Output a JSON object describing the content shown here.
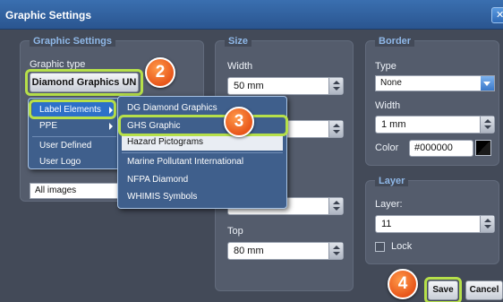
{
  "window": {
    "title": "Graphic Settings",
    "close_icon": "close-icon"
  },
  "graphic_settings": {
    "legend": "Graphic Settings",
    "type_label": "Graphic type",
    "type_button": "Diamond Graphics UN",
    "type_dropdown_partial": "All images"
  },
  "menu": {
    "items": [
      {
        "label": "Label Elements",
        "has_submenu": true,
        "selected": true
      },
      {
        "label": "PPE",
        "has_submenu": true
      },
      {
        "label": "User Defined",
        "has_submenu": false
      },
      {
        "label": "User Logo",
        "has_submenu": false
      }
    ]
  },
  "submenu": {
    "items": [
      {
        "label": "DG Diamond Graphics"
      },
      {
        "label": "GHS Graphic"
      },
      {
        "label": "Hazard Pictograms",
        "hover": true
      },
      {
        "label": "Marine Pollutant International"
      },
      {
        "label": "NFPA Diamond"
      },
      {
        "label": "WHIMIS Symbols"
      }
    ]
  },
  "size": {
    "legend": "Size",
    "width_label": "Width",
    "width_value": "50 mm",
    "top_label": "Top",
    "top_value": "80 mm"
  },
  "border": {
    "legend": "Border",
    "type_label": "Type",
    "type_value": "None",
    "width_label": "Width",
    "width_value": "1 mm",
    "color_label": "Color",
    "color_value": "#000000"
  },
  "layer": {
    "legend": "Layer",
    "layer_label": "Layer:",
    "layer_value": "11",
    "lock_label": "Lock",
    "lock_checked": false
  },
  "buttons": {
    "save": "Save",
    "cancel": "Cancel"
  },
  "steps": {
    "s2": "2",
    "s3": "3",
    "s4": "4"
  },
  "colors": {
    "accent": "#b6e04a",
    "badge": "#e8561a",
    "title_bar": "#2a5590",
    "legend": "#8fb8e8"
  }
}
